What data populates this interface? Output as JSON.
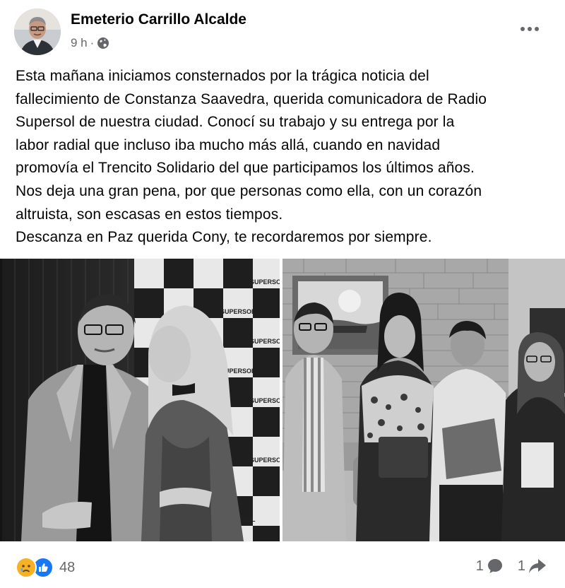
{
  "post": {
    "author": "Emeterio Carrillo Alcalde",
    "time": "9 h",
    "separator": "·",
    "audience_icon": "globe-icon",
    "more_icon": "more-options-icon",
    "text_lines": [
      "Esta mañana iniciamos consternados por la trágica noticia del",
      "fallecimiento de Constanza Saavedra, querida comunicadora de Radio",
      "Supersol de nuestra ciudad. Conocí su trabajo y su entrega por la",
      "labor radial que incluso iba mucho más allá, cuando en navidad",
      "promovía el Trencito Solidario del que participamos los últimos años.",
      "Nos deja una gran pena, por que personas como ella, con un corazón",
      "altruista, son escasas en estos tiempos.",
      "Descanza en Paz querida Cony, te recordaremos por siempre."
    ],
    "photos": {
      "backdrop_logo_text": "SUPERSOL"
    }
  },
  "footer": {
    "reaction_icons": [
      "sad-reaction-icon",
      "like-reaction-icon"
    ],
    "reaction_count": "48",
    "comment_count": "1",
    "share_count": "1"
  },
  "colors": {
    "text": "#050505",
    "secondary": "#65676b",
    "like_blue": "#1877f2",
    "sad_yellow": "#f7b125"
  }
}
